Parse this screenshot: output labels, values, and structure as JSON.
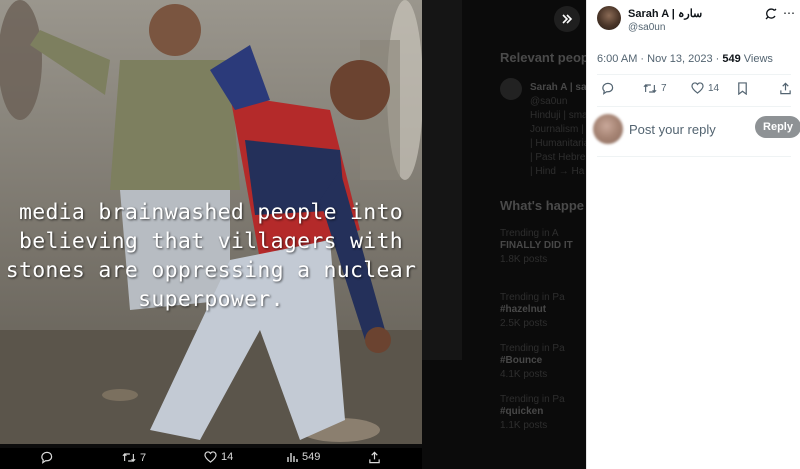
{
  "media": {
    "overlay_text": "media brainwashed people into believing that villagers with stones are oppressing a nuclear superpower.",
    "actions": {
      "reply_count": "",
      "retweet_count": "7",
      "like_count": "14",
      "views_count": "549"
    }
  },
  "background": {
    "relevant_heading": "Relevant peop",
    "relevant_name": "Sarah A | sa",
    "relevant_lines": [
      "@sa0un",
      "Hinduji | sma",
      "Journalism |",
      "| Humanitarian",
      "| Past Hebre",
      "| Hind → Ha"
    ],
    "trending_heading": "What's happe",
    "trends": [
      {
        "context": "Trending in A",
        "topic": "FINALLY DID IT",
        "posts": "1.8K posts"
      },
      {
        "context": "Trending in Pa",
        "topic": "#hazelnut",
        "posts": "2.5K posts"
      },
      {
        "context": "Trending in Pa",
        "topic": "#Bounce",
        "posts": "4.1K posts"
      },
      {
        "context": "Trending in Pa",
        "topic": "#quicken",
        "posts": "1.1K posts"
      }
    ]
  },
  "tweet": {
    "author_name": "Sarah A | سارہ",
    "author_handle": "@sa0un",
    "time": "6:00 AM · Nov 13, 2023 · ",
    "views": "549",
    "views_label": " Views",
    "actions": {
      "reply_count": "",
      "retweet_count": "7",
      "like_count": "14"
    },
    "reply_placeholder": "Post your reply",
    "reply_button": "Reply"
  },
  "icons": [
    "expand-icon",
    "grok-icon",
    "more-icon",
    "reply-icon",
    "retweet-icon",
    "like-icon",
    "bookmark-icon",
    "share-icon",
    "views-icon"
  ]
}
